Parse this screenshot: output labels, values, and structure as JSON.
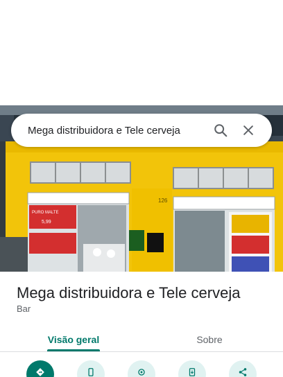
{
  "search": {
    "query": "Mega distribuidora e Tele cerveja",
    "search_icon": "search-icon",
    "close_icon": "close-icon"
  },
  "photo": {
    "house_number": "126",
    "banner_text": "PURO MALTE",
    "banner_price": "5,99"
  },
  "place": {
    "title": "Mega distribuidora e Tele cerveja",
    "category": "Bar"
  },
  "tabs": [
    {
      "label": "Visão geral",
      "active": true
    },
    {
      "label": "Sobre",
      "active": false
    }
  ],
  "actions": [
    {
      "icon": "directions-icon"
    },
    {
      "icon": "phone-icon"
    },
    {
      "icon": "location-icon"
    },
    {
      "icon": "send-to-phone-icon"
    },
    {
      "icon": "share-icon"
    }
  ],
  "colors": {
    "accent": "#00796b",
    "accent_light": "#e0f2f1",
    "facade_yellow": "#f2c40a"
  }
}
